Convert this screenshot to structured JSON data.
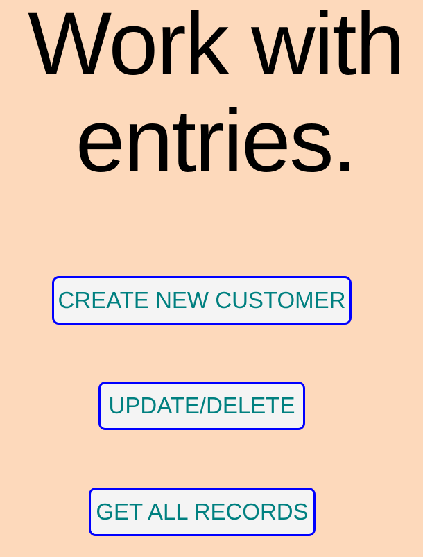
{
  "title": "Work with entries.",
  "buttons": {
    "create": "CREATE NEW CUSTOMER",
    "update_delete": "UPDATE/DELETE",
    "get_all": "GET ALL RECORDS"
  },
  "colors": {
    "background": "#fdd9bb",
    "button_border": "#0000ff",
    "button_text": "#008080",
    "button_bg": "#f4f4f4"
  }
}
